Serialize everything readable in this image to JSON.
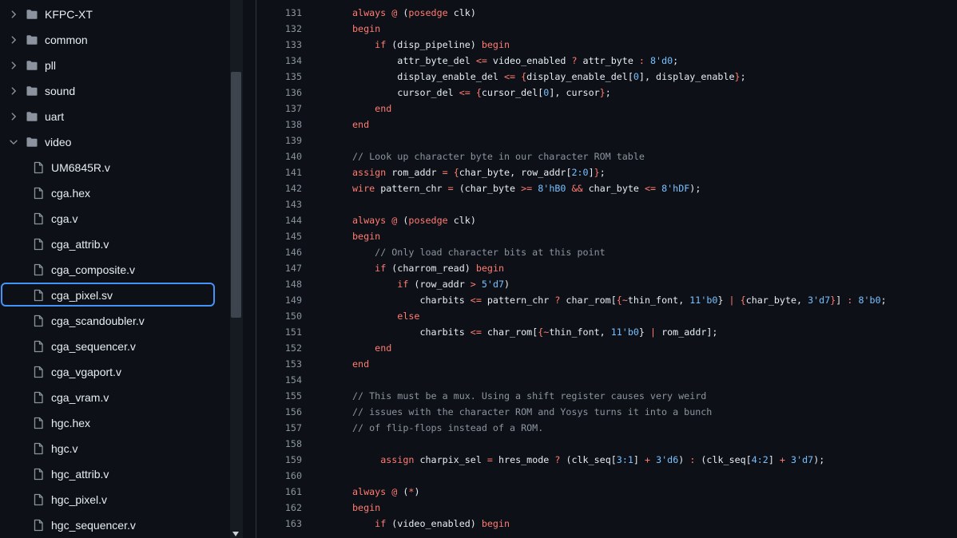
{
  "sidebar": {
    "items": [
      {
        "type": "folder",
        "label": "KFPC-XT",
        "expanded": false
      },
      {
        "type": "folder",
        "label": "common",
        "expanded": false
      },
      {
        "type": "folder",
        "label": "pll",
        "expanded": false
      },
      {
        "type": "folder",
        "label": "sound",
        "expanded": false
      },
      {
        "type": "folder",
        "label": "uart",
        "expanded": false
      },
      {
        "type": "folder",
        "label": "video",
        "expanded": true
      },
      {
        "type": "file",
        "label": "UM6845R.v"
      },
      {
        "type": "file",
        "label": "cga.hex"
      },
      {
        "type": "file",
        "label": "cga.v"
      },
      {
        "type": "file",
        "label": "cga_attrib.v"
      },
      {
        "type": "file",
        "label": "cga_composite.v"
      },
      {
        "type": "file",
        "label": "cga_pixel.sv",
        "selected": true
      },
      {
        "type": "file",
        "label": "cga_scandoubler.v"
      },
      {
        "type": "file",
        "label": "cga_sequencer.v"
      },
      {
        "type": "file",
        "label": "cga_vgaport.v"
      },
      {
        "type": "file",
        "label": "cga_vram.v"
      },
      {
        "type": "file",
        "label": "hgc.hex"
      },
      {
        "type": "file",
        "label": "hgc.v"
      },
      {
        "type": "file",
        "label": "hgc_attrib.v"
      },
      {
        "type": "file",
        "label": "hgc_pixel.v"
      },
      {
        "type": "file",
        "label": "hgc_sequencer.v"
      }
    ]
  },
  "colors": {
    "background": "#0d1117",
    "keyword": "#ff7b72",
    "number": "#79c0ff",
    "comment": "#8b949e",
    "text": "#e6edf3",
    "selection_border": "#4493f8"
  },
  "code": {
    "lines": [
      {
        "n": "131",
        "t": [
          [
            "always",
            "kw"
          ],
          [
            " ",
            ""
          ],
          [
            "@",
            "op"
          ],
          [
            " (",
            ""
          ],
          [
            "posedge",
            "kw"
          ],
          [
            " clk)",
            ""
          ]
        ]
      },
      {
        "n": "132",
        "t": [
          [
            "begin",
            "kw"
          ]
        ]
      },
      {
        "n": "133",
        "t": [
          [
            "    ",
            ""
          ],
          [
            "if",
            "kw"
          ],
          [
            " (disp_pipeline) ",
            ""
          ],
          [
            "begin",
            "kw"
          ]
        ]
      },
      {
        "n": "134",
        "t": [
          [
            "        attr_byte_del ",
            ""
          ],
          [
            "<=",
            "op"
          ],
          [
            " video_enabled ",
            ""
          ],
          [
            "?",
            "op"
          ],
          [
            " attr_byte ",
            ""
          ],
          [
            ":",
            "op"
          ],
          [
            " ",
            ""
          ],
          [
            "8'd0",
            "num"
          ],
          [
            ";",
            ""
          ]
        ]
      },
      {
        "n": "135",
        "t": [
          [
            "        display_enable_del ",
            ""
          ],
          [
            "<=",
            "op"
          ],
          [
            " ",
            ""
          ],
          [
            "{",
            "op"
          ],
          [
            "display_enable_del[",
            ""
          ],
          [
            "0",
            "num"
          ],
          [
            "], display_enable",
            ""
          ],
          [
            "}",
            "op"
          ],
          [
            ";",
            ""
          ]
        ]
      },
      {
        "n": "136",
        "t": [
          [
            "        cursor_del ",
            ""
          ],
          [
            "<=",
            "op"
          ],
          [
            " ",
            ""
          ],
          [
            "{",
            "op"
          ],
          [
            "cursor_del[",
            ""
          ],
          [
            "0",
            "num"
          ],
          [
            "], cursor",
            ""
          ],
          [
            "}",
            "op"
          ],
          [
            ";",
            ""
          ]
        ]
      },
      {
        "n": "137",
        "t": [
          [
            "    ",
            ""
          ],
          [
            "end",
            "kw"
          ]
        ]
      },
      {
        "n": "138",
        "t": [
          [
            "end",
            "kw"
          ]
        ]
      },
      {
        "n": "139",
        "t": []
      },
      {
        "n": "140",
        "t": [
          [
            "// Look up character byte in our character ROM table",
            "cm"
          ]
        ]
      },
      {
        "n": "141",
        "t": [
          [
            "assign",
            "kw"
          ],
          [
            " rom_addr ",
            ""
          ],
          [
            "=",
            "op"
          ],
          [
            " ",
            ""
          ],
          [
            "{",
            "op"
          ],
          [
            "char_byte, row_addr[",
            ""
          ],
          [
            "2:0",
            "num"
          ],
          [
            "]",
            ""
          ],
          [
            "}",
            "op"
          ],
          [
            ";",
            ""
          ]
        ]
      },
      {
        "n": "142",
        "t": [
          [
            "wire",
            "kw"
          ],
          [
            " pattern_chr ",
            ""
          ],
          [
            "=",
            "op"
          ],
          [
            " (char_byte ",
            ""
          ],
          [
            ">=",
            "op"
          ],
          [
            " ",
            ""
          ],
          [
            "8'hB0",
            "num"
          ],
          [
            " ",
            ""
          ],
          [
            "&&",
            "op"
          ],
          [
            " char_byte ",
            ""
          ],
          [
            "<=",
            "op"
          ],
          [
            " ",
            ""
          ],
          [
            "8'hDF",
            "num"
          ],
          [
            ");",
            ""
          ]
        ]
      },
      {
        "n": "143",
        "t": []
      },
      {
        "n": "144",
        "t": [
          [
            "always",
            "kw"
          ],
          [
            " ",
            ""
          ],
          [
            "@",
            "op"
          ],
          [
            " (",
            ""
          ],
          [
            "posedge",
            "kw"
          ],
          [
            " clk)",
            ""
          ]
        ]
      },
      {
        "n": "145",
        "t": [
          [
            "begin",
            "kw"
          ]
        ]
      },
      {
        "n": "146",
        "t": [
          [
            "    ",
            ""
          ],
          [
            "// Only load character bits at this point",
            "cm"
          ]
        ]
      },
      {
        "n": "147",
        "t": [
          [
            "    ",
            ""
          ],
          [
            "if",
            "kw"
          ],
          [
            " (charrom_read) ",
            ""
          ],
          [
            "begin",
            "kw"
          ]
        ]
      },
      {
        "n": "148",
        "t": [
          [
            "        ",
            ""
          ],
          [
            "if",
            "kw"
          ],
          [
            " (row_addr ",
            ""
          ],
          [
            ">",
            "op"
          ],
          [
            " ",
            ""
          ],
          [
            "5'd7",
            "num"
          ],
          [
            ")",
            ""
          ]
        ]
      },
      {
        "n": "149",
        "t": [
          [
            "            charbits ",
            ""
          ],
          [
            "<=",
            "op"
          ],
          [
            " pattern_chr ",
            ""
          ],
          [
            "?",
            "op"
          ],
          [
            " char_rom[",
            ""
          ],
          [
            "{",
            "op"
          ],
          [
            "~",
            "op"
          ],
          [
            "thin_font, ",
            ""
          ],
          [
            "11'b0",
            "num"
          ],
          [
            "}",
            ""
          ],
          [
            " ",
            ""
          ],
          [
            "|",
            "op"
          ],
          [
            " ",
            ""
          ],
          [
            "{",
            "op"
          ],
          [
            "char_byte, ",
            ""
          ],
          [
            "3'd7",
            "num"
          ],
          [
            "}",
            "op"
          ],
          [
            "] ",
            ""
          ],
          [
            ":",
            "op"
          ],
          [
            " ",
            ""
          ],
          [
            "8'b0",
            "num"
          ],
          [
            ";",
            ""
          ]
        ]
      },
      {
        "n": "150",
        "t": [
          [
            "        ",
            ""
          ],
          [
            "else",
            "kw"
          ]
        ]
      },
      {
        "n": "151",
        "t": [
          [
            "            charbits ",
            ""
          ],
          [
            "<=",
            "op"
          ],
          [
            " char_rom[",
            ""
          ],
          [
            "{",
            "op"
          ],
          [
            "~",
            "op"
          ],
          [
            "thin_font, ",
            ""
          ],
          [
            "11'b0",
            "num"
          ],
          [
            "}",
            ""
          ],
          [
            " ",
            ""
          ],
          [
            "|",
            "op"
          ],
          [
            " rom_addr];",
            ""
          ]
        ]
      },
      {
        "n": "152",
        "t": [
          [
            "    ",
            ""
          ],
          [
            "end",
            "kw"
          ]
        ]
      },
      {
        "n": "153",
        "t": [
          [
            "end",
            "kw"
          ]
        ]
      },
      {
        "n": "154",
        "t": []
      },
      {
        "n": "155",
        "t": [
          [
            "// This must be a mux. Using a shift register causes very weird",
            "cm"
          ]
        ]
      },
      {
        "n": "156",
        "t": [
          [
            "// issues with the character ROM and Yosys turns it into a bunch",
            "cm"
          ]
        ]
      },
      {
        "n": "157",
        "t": [
          [
            "// of flip-flops instead of a ROM.",
            "cm"
          ]
        ]
      },
      {
        "n": "158",
        "t": []
      },
      {
        "n": "159",
        "t": [
          [
            "     ",
            ""
          ],
          [
            "assign",
            "kw"
          ],
          [
            " charpix_sel ",
            ""
          ],
          [
            "=",
            "op"
          ],
          [
            " hres_mode ",
            ""
          ],
          [
            "?",
            "op"
          ],
          [
            " (clk_seq[",
            ""
          ],
          [
            "3:1",
            "num"
          ],
          [
            "] ",
            ""
          ],
          [
            "+",
            "op"
          ],
          [
            " ",
            ""
          ],
          [
            "3'd6",
            "num"
          ],
          [
            ") ",
            ""
          ],
          [
            ":",
            "op"
          ],
          [
            " (clk_seq[",
            ""
          ],
          [
            "4:2",
            "num"
          ],
          [
            "] ",
            ""
          ],
          [
            "+",
            "op"
          ],
          [
            " ",
            ""
          ],
          [
            "3'd7",
            "num"
          ],
          [
            ");",
            ""
          ]
        ]
      },
      {
        "n": "160",
        "t": []
      },
      {
        "n": "161",
        "t": [
          [
            "always",
            "kw"
          ],
          [
            " ",
            ""
          ],
          [
            "@",
            "op"
          ],
          [
            " (",
            ""
          ],
          [
            "*",
            "op"
          ],
          [
            ")",
            ""
          ]
        ]
      },
      {
        "n": "162",
        "t": [
          [
            "begin",
            "kw"
          ]
        ]
      },
      {
        "n": "163",
        "t": [
          [
            "    ",
            ""
          ],
          [
            "if",
            "kw"
          ],
          [
            " (video_enabled) ",
            ""
          ],
          [
            "begin",
            "kw"
          ]
        ]
      }
    ]
  }
}
